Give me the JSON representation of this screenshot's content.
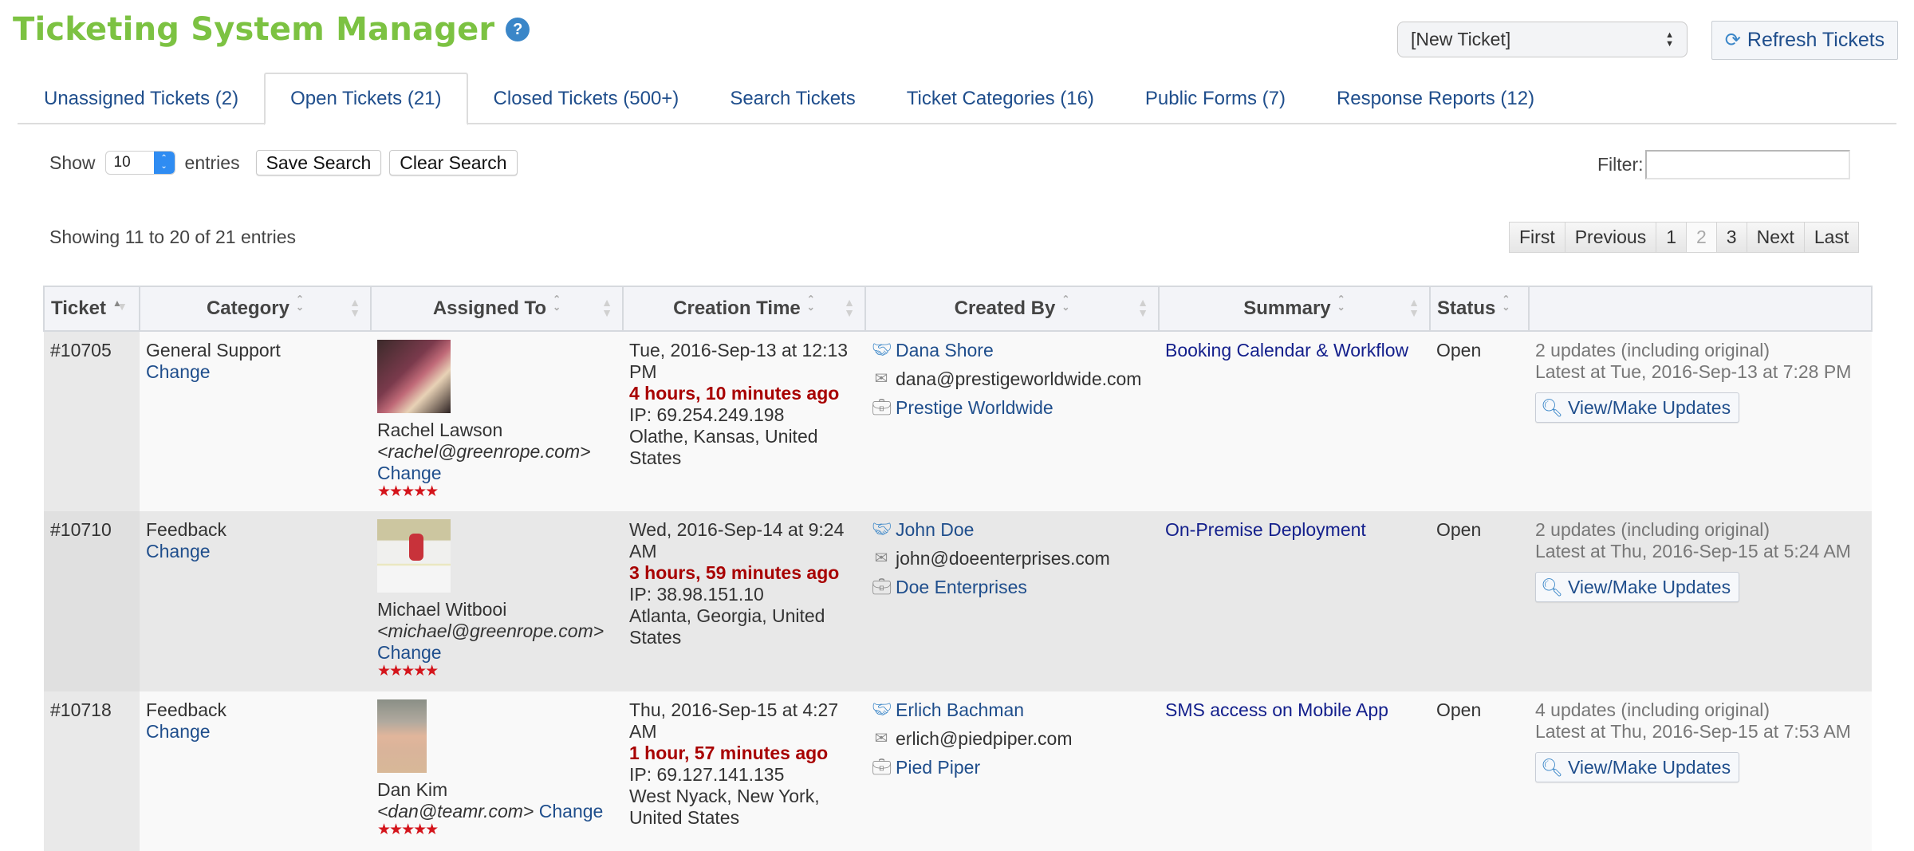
{
  "header": {
    "title": "Ticketing System Manager",
    "help_icon": "?",
    "new_ticket_select": "[New Ticket]",
    "refresh_button": "Refresh Tickets"
  },
  "tabs": [
    {
      "label": "Unassigned Tickets (2)",
      "active": false
    },
    {
      "label": "Open Tickets (21)",
      "active": true
    },
    {
      "label": "Closed Tickets (500+)",
      "active": false
    },
    {
      "label": "Search Tickets",
      "active": false
    },
    {
      "label": "Ticket Categories (16)",
      "active": false
    },
    {
      "label": "Public Forms (7)",
      "active": false
    },
    {
      "label": "Response Reports (12)",
      "active": false
    }
  ],
  "controls": {
    "show_label": "Show",
    "entries_value": "10",
    "entries_label": "entries",
    "save_search": "Save Search",
    "clear_search": "Clear Search",
    "filter_label": "Filter:",
    "filter_value": "",
    "showing_text": "Showing 11 to 20 of 21 entries"
  },
  "pagination": {
    "first": "First",
    "previous": "Previous",
    "pages": [
      "1",
      "2",
      "3"
    ],
    "current_page": "2",
    "next": "Next",
    "last": "Last"
  },
  "table": {
    "columns": [
      "Ticket",
      "Category",
      "Assigned To",
      "Creation Time",
      "Created By",
      "Summary",
      "Status",
      ""
    ],
    "sorted_column": "Ticket",
    "rows": [
      {
        "ticket": "#10705",
        "category": "General Support",
        "category_change": "Change",
        "assignee_name": "Rachel Lawson",
        "assignee_email": "<rachel@greenrope.com>",
        "assignee_change": "Change",
        "rating": 5,
        "rating_stars": "★★★★★",
        "created_date": "Tue, 2016-Sep-13 at 12:13 PM",
        "created_ago": "4 hours, 10 minutes ago",
        "created_ip": "IP: 69.254.249.198",
        "created_location": "Olathe, Kansas, United States",
        "creator_name": "Dana Shore",
        "creator_email": "dana@prestigeworldwide.com",
        "creator_company": "Prestige Worldwide",
        "summary": "Booking Calendar & Workflow",
        "status": "Open",
        "updates_count": "2 updates (including original)",
        "updates_latest": "Latest at Tue, 2016-Sep-13 at 7:28 PM",
        "view_button": "View/Make Updates"
      },
      {
        "ticket": "#10710",
        "category": "Feedback",
        "category_change": "Change",
        "assignee_name": "Michael Witbooi",
        "assignee_email": "<michael@greenrope.com>",
        "assignee_change": "Change",
        "rating": 5,
        "rating_stars": "★★★★★",
        "created_date": "Wed, 2016-Sep-14 at 9:24 AM",
        "created_ago": "3 hours, 59 minutes ago",
        "created_ip": "IP: 38.98.151.10",
        "created_location": "Atlanta, Georgia, United States",
        "creator_name": "John Doe",
        "creator_email": "john@doeenterprises.com",
        "creator_company": "Doe Enterprises",
        "summary": "On-Premise Deployment",
        "status": "Open",
        "updates_count": "2 updates (including original)",
        "updates_latest": "Latest at Thu, 2016-Sep-15 at 5:24 AM",
        "view_button": "View/Make Updates"
      },
      {
        "ticket": "#10718",
        "category": "Feedback",
        "category_change": "Change",
        "assignee_name": "Dan Kim",
        "assignee_email": "<dan@teamr.com>",
        "assignee_change": "Change",
        "rating": 5,
        "rating_stars": "★★★★★",
        "created_date": "Thu, 2016-Sep-15 at 4:27 AM",
        "created_ago": "1 hour, 57 minutes ago",
        "created_ip": "IP: 69.127.141.135",
        "created_location": "West Nyack, New York, United States",
        "creator_name": "Erlich Bachman",
        "creator_email": "erlich@piedpiper.com",
        "creator_company": "Pied Piper",
        "summary": "SMS access on Mobile App",
        "status": "Open",
        "updates_count": "4 updates (including original)",
        "updates_latest": "Latest at Thu, 2016-Sep-15 at 7:53 AM",
        "view_button": "View/Make Updates"
      }
    ]
  },
  "icons": {
    "help": "question-mark-circle",
    "refresh": "refresh-arrows",
    "contact": "handshake",
    "email": "envelope",
    "company": "briefcase",
    "view": "magnifier",
    "rating": "red-star"
  },
  "colors": {
    "title_green": "#7cc242",
    "link_blue": "#1f4e8c",
    "summary_blue": "#14208c",
    "ago_red": "#a80000",
    "star_red": "#d4141b"
  }
}
